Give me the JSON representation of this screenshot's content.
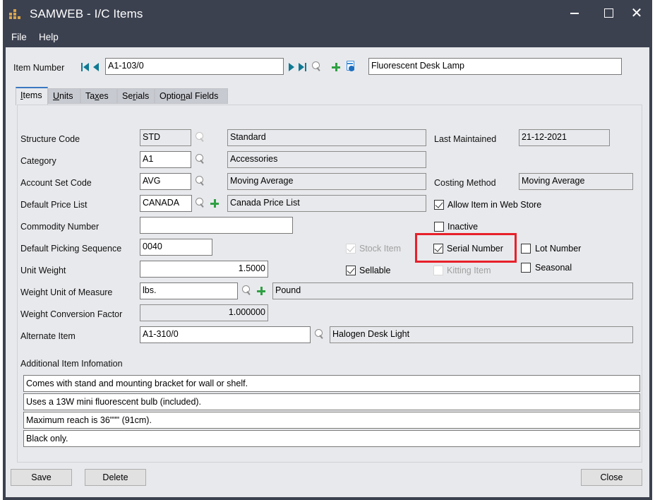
{
  "window": {
    "title": "SAMWEB - I/C Items",
    "controls": {
      "minimize": "minimize",
      "maximize": "maximize",
      "close": "✕"
    }
  },
  "menu": [
    "File",
    "Help"
  ],
  "header": {
    "item_number_label": "Item Number",
    "item_number": "A1-103/0",
    "description": "Fluorescent Desk Lamp"
  },
  "tabs": [
    {
      "label": "Items",
      "active": true
    },
    {
      "label": "Units",
      "active": false
    },
    {
      "label": "Taxes",
      "active": false
    },
    {
      "label": "Serials",
      "active": false
    },
    {
      "label": "Optional Fields",
      "active": false
    }
  ],
  "tab_mnemonics": {
    "items": {
      "pre": "",
      "u": "I",
      "post": "tems"
    },
    "units": {
      "pre": "",
      "u": "U",
      "post": "nits"
    },
    "taxes": {
      "pre": "Ta",
      "u": "x",
      "post": "es"
    },
    "serials": {
      "pre": "Se",
      "u": "r",
      "post": "ials"
    },
    "optional": {
      "pre": "Optio",
      "u": "n",
      "post": "al Fields"
    }
  },
  "form": {
    "structure_code": {
      "label": "Structure Code",
      "value": "STD",
      "desc": "Standard"
    },
    "category": {
      "label": "Category",
      "value": "A1",
      "desc": "Accessories"
    },
    "account_set": {
      "label": "Account Set Code",
      "value": "AVG",
      "desc": "Moving Average"
    },
    "price_list": {
      "label": "Default Price List",
      "value": "CANADA",
      "desc": "Canada Price List"
    },
    "commodity": {
      "label": "Commodity Number",
      "value": ""
    },
    "picking_seq": {
      "label": "Default Picking Sequence",
      "value": "0040"
    },
    "unit_weight": {
      "label": "Unit Weight",
      "value": "1.5000"
    },
    "weight_uom": {
      "label": "Weight Unit of Measure",
      "value": "lbs.",
      "desc": "Pound"
    },
    "weight_conv": {
      "label": "Weight Conversion Factor",
      "value": "1.000000"
    },
    "alternate": {
      "label": "Alternate Item",
      "value": "A1-310/0",
      "desc": "Halogen Desk Light"
    },
    "last_maintained": {
      "label": "Last Maintained",
      "value": "21-12-2021"
    },
    "costing_method": {
      "label": "Costing Method",
      "value": "Moving Average"
    },
    "additional_label": "Additional Item Infomation",
    "additional_lines": [
      "Comes with stand and mounting bracket for wall or shelf.",
      "Uses a 13W mini fluorescent bulb (included).",
      "Maximum reach is 36\"\"\" (91cm).",
      "Black only."
    ]
  },
  "checkboxes": {
    "web_store": {
      "label": "Allow Item in Web Store",
      "checked": true
    },
    "inactive": {
      "label": "Inactive",
      "checked": false
    },
    "stock_item": {
      "label": "Stock Item",
      "checked": true,
      "disabled": true
    },
    "serial_number": {
      "label": "Serial Number",
      "checked": true
    },
    "lot_number": {
      "label": "Lot Number",
      "checked": false
    },
    "sellable": {
      "label": "Sellable",
      "checked": true
    },
    "kitting_item": {
      "label": "Kitting Item",
      "checked": false,
      "disabled": true
    },
    "seasonal": {
      "label": "Seasonal",
      "checked": false
    }
  },
  "buttons": {
    "save": "Save",
    "delete": "Delete",
    "close": "Close"
  },
  "colors": {
    "titlebar": "#3c4150",
    "highlight": "#e8202a",
    "nav_arrows": "#0f7a94",
    "add_green": "#2fa043"
  }
}
